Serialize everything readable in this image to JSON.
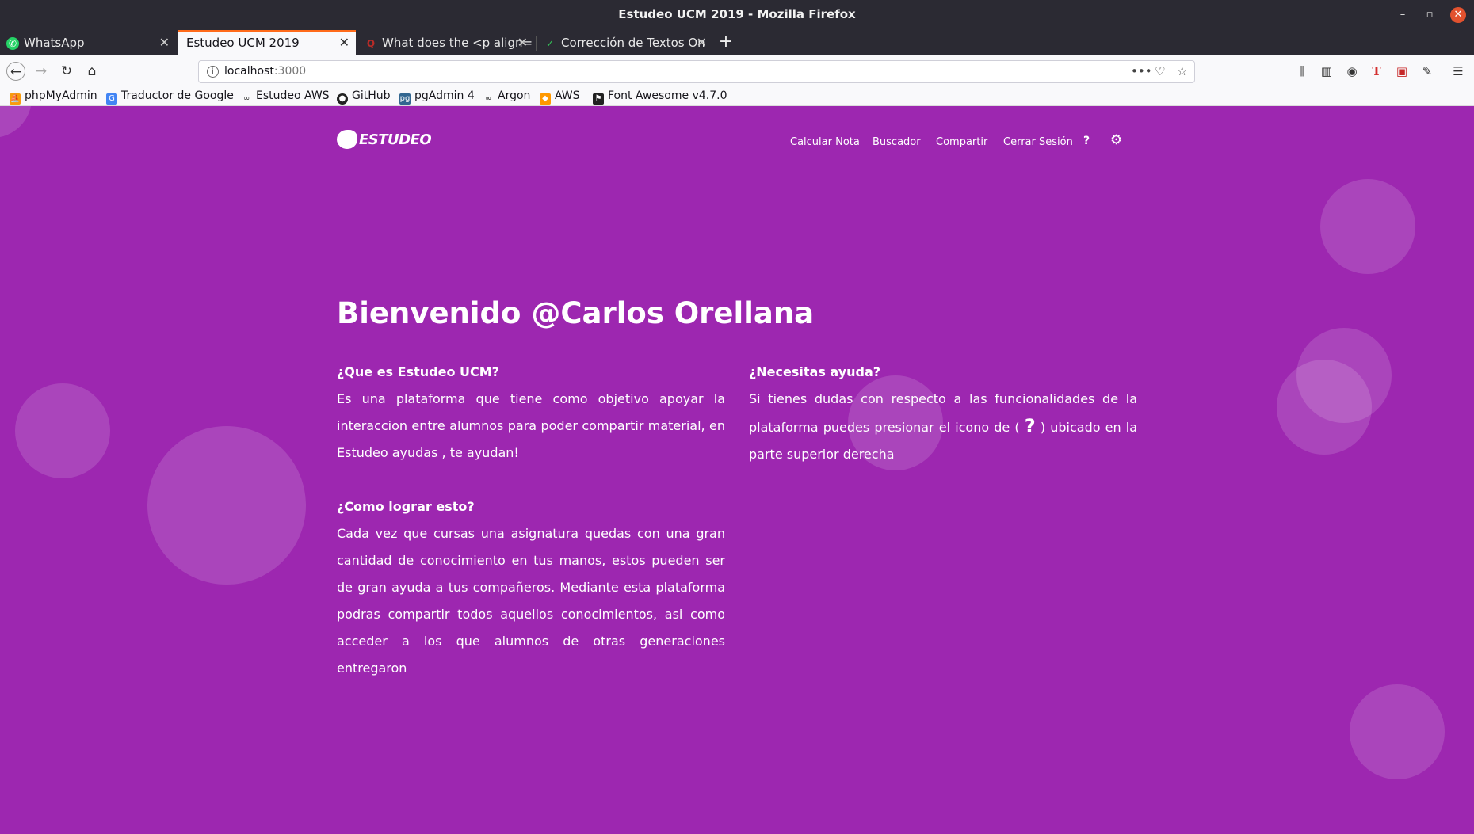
{
  "window": {
    "title": "Estudeo UCM 2019 - Mozilla Firefox"
  },
  "tabs": [
    {
      "label": "WhatsApp",
      "icon": "whatsapp-icon"
    },
    {
      "label": "Estudeo UCM 2019",
      "icon": ""
    },
    {
      "label": "What does the <p align=",
      "icon": "quora-icon"
    },
    {
      "label": "Corrección de Textos On",
      "icon": "check-icon"
    }
  ],
  "address": {
    "host": "localhost",
    "port": ":3000"
  },
  "bookmarks": [
    "phpMyAdmin",
    "Traductor de Google",
    "Estudeo AWS",
    "GitHub",
    "pgAdmin 4",
    "Argon",
    "AWS",
    "Font Awesome v4.7.0"
  ],
  "site": {
    "logo": "ESTUDEO",
    "nav": [
      "Calcular Nota",
      "Buscador",
      "Compartir",
      "Cerrar Sesión"
    ],
    "help_icon": "?",
    "welcome": "Bienvenido @Carlos Orellana",
    "sections": {
      "what_title": "¿Que es Estudeo UCM?",
      "what_body": "Es una plataforma que tiene como objetivo apoyar la interaccion entre alumnos para poder compartir material, en Estudeo ayudas , te ayudan!",
      "how_title": "¿Como lograr esto?",
      "how_body": "Cada vez que cursas una asignatura quedas con una gran cantidad de conocimiento en tus manos, estos pueden ser de gran ayuda a tus compañeros. Mediante esta plataforma podras compartir todos aquellos conocimientos, asi como acceder a los que alumnos de otras generaciones entregaron",
      "help_title": "¿Necesitas ayuda?",
      "help_body_1": "Si tienes dudas con respecto a las funcionalidades de la plataforma puedes presionar el icono de (",
      "help_q": "?",
      "help_body_2": ") ubicado en la parte superior derecha"
    }
  },
  "colors": {
    "page_bg": "#9d27b0",
    "tab_accent": "#ff6b1a"
  }
}
